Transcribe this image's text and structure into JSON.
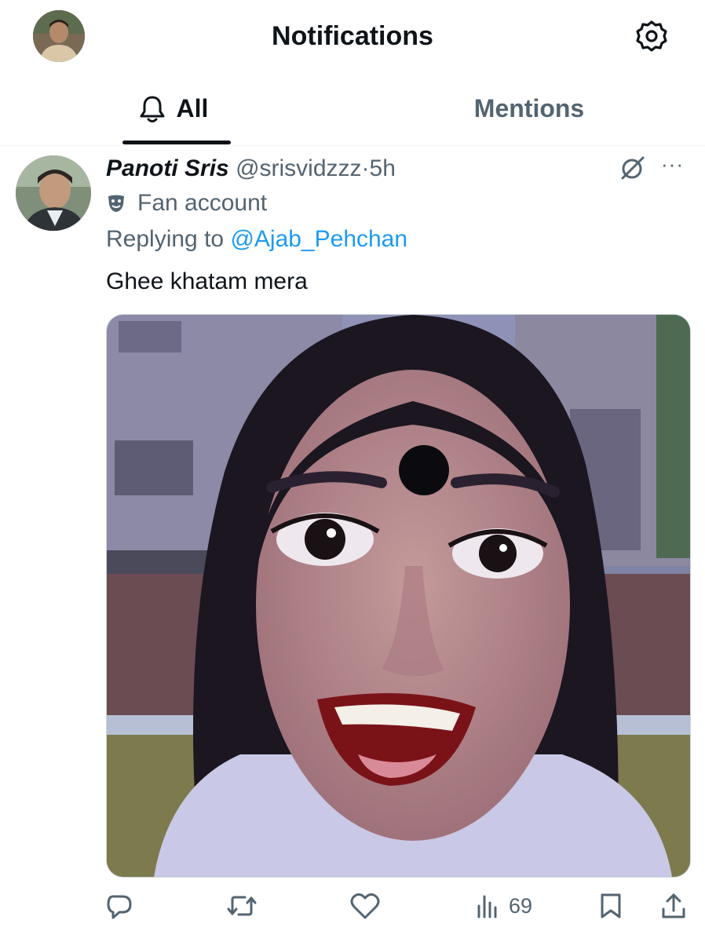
{
  "header": {
    "title": "Notifications"
  },
  "tabs": [
    {
      "label": "All"
    },
    {
      "label": "Mentions"
    }
  ],
  "tweet": {
    "display_name": "Panoti Sris",
    "handle": "@srisvidzzz",
    "separator": "·",
    "time": "5h",
    "label": "Fan account",
    "replying_prefix": "Replying to",
    "replying_to": "@Ajab_Pehchan",
    "text": "Ghee khatam mera",
    "more": "···",
    "views": "69"
  },
  "icons": {
    "settings": "gear-icon",
    "tab_all": "bell-icon",
    "fan_label": "theater-mask-icon",
    "grok": "grok-icon",
    "reply": "reply-icon",
    "repost": "repost-icon",
    "like": "heart-icon",
    "views": "views-icon",
    "bookmark": "bookmark-icon",
    "share": "share-icon"
  },
  "colors": {
    "accent": "#1d9bf0",
    "text": "#0f1419",
    "secondary": "#536471"
  }
}
